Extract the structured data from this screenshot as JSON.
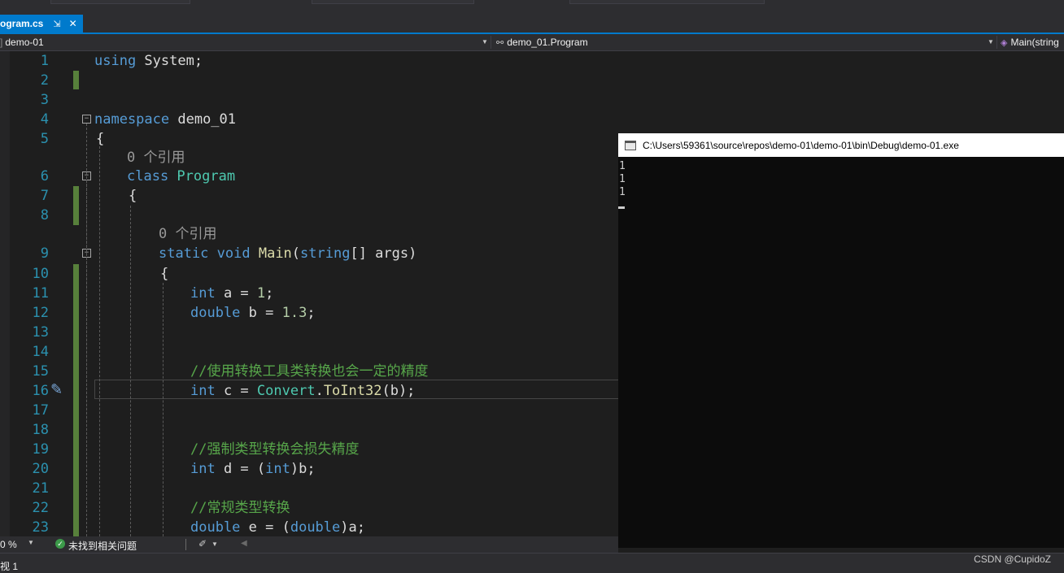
{
  "tab": {
    "title": "ogram.cs",
    "pin": "⇲",
    "close": "✕"
  },
  "nav": {
    "project": "demo-01",
    "class": "demo_01.Program",
    "member": "Main(string"
  },
  "editor": {
    "lines": [
      {
        "num": "1"
      },
      {
        "num": "2"
      },
      {
        "num": "3"
      },
      {
        "num": "4"
      },
      {
        "num": "5"
      },
      {
        "num": "6"
      },
      {
        "num": "7"
      },
      {
        "num": "8"
      },
      {
        "num": "9"
      },
      {
        "num": "10"
      },
      {
        "num": "11"
      },
      {
        "num": "12"
      },
      {
        "num": "13"
      },
      {
        "num": "14"
      },
      {
        "num": "15"
      },
      {
        "num": "16"
      },
      {
        "num": "17"
      },
      {
        "num": "18"
      },
      {
        "num": "19"
      },
      {
        "num": "20"
      },
      {
        "num": "21"
      },
      {
        "num": "22"
      },
      {
        "num": "23"
      }
    ],
    "code": {
      "using_kw": "using",
      "using_rest": " System;",
      "namespace_kw": "namespace",
      "namespace_name": " demo_01",
      "brace_open": "{",
      "brace_open2": "{",
      "brace_open3": "{",
      "refs_class": "0 个引用",
      "refs_main": "0 个引用",
      "class_kw": "class",
      "class_name": " Program",
      "static_kw": "static",
      "void_kw": " void",
      "main_name": " Main",
      "main_paren": "(",
      "string_kw": "string",
      "main_args": "[] args)",
      "l11_kw": "int",
      "l11_rest": " a = ",
      "l11_num": "1",
      "l11_end": ";",
      "l12_kw": "double",
      "l12_rest": " b = ",
      "l12_num": "1.3",
      "l12_end": ";",
      "l15_comment": "//使用转换工具类转换也会一定的精度",
      "l16_kw": "int",
      "l16_rest": " c = ",
      "l16_type": "Convert",
      "l16_dot": ".",
      "l16_fn": "ToInt32",
      "l16_end": "(b);",
      "l19_comment": "//强制类型转换会损失精度",
      "l20_kw": "int",
      "l20_rest": " d = (",
      "l20_cast": "int",
      "l20_end": ")b;",
      "l22_comment": "//常规类型转换",
      "l23_kw": "double",
      "l23_rest": " e = (",
      "l23_cast": "double",
      "l23_end": ")a;"
    }
  },
  "status": {
    "zoom": "0 %",
    "issues": "未找到相关问题"
  },
  "bottom": {
    "view": "视 1"
  },
  "console": {
    "title": "C:\\Users\\59361\\source\\repos\\demo-01\\demo-01\\bin\\Debug\\demo-01.exe",
    "output": "1\n1\n1"
  },
  "watermark": "CSDN @CupidoZ",
  "colors": {
    "accent": "#007acc",
    "keyword": "#569cd6",
    "type": "#4ec9b0",
    "comment": "#57a64a",
    "number": "#b5cea8"
  }
}
